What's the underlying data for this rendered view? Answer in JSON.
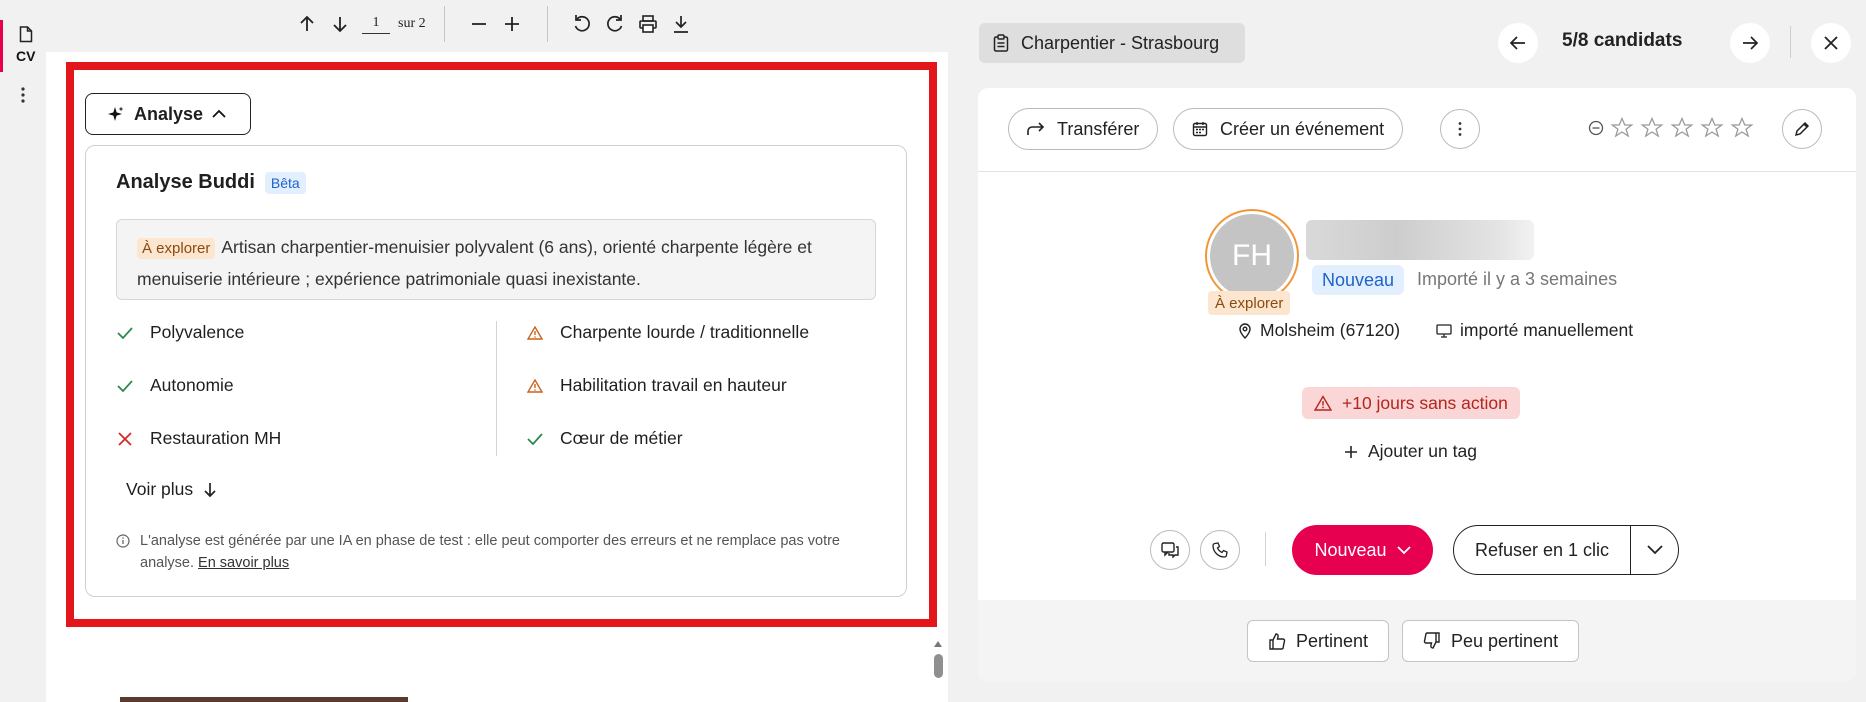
{
  "rail": {
    "cv_label": "CV",
    "icons": [
      "document-icon",
      "more-vertical-icon"
    ]
  },
  "pdf_toolbar": {
    "page_current": "1",
    "page_total": "sur 2"
  },
  "analysis": {
    "toggle_label": "Analyse",
    "title": "Analyse Buddi",
    "beta_badge": "Bêta",
    "summary_tag": "À explorer",
    "summary_text": "Artisan charpentier-menuisier polyvalent (6 ans), orienté charpente légère et menuiserie intérieure ; expérience patrimoniale quasi inexistante.",
    "criteria_left": [
      {
        "label": "Polyvalence",
        "status": "match"
      },
      {
        "label": "Autonomie",
        "status": "match"
      },
      {
        "label": "Restauration MH",
        "status": "miss"
      }
    ],
    "criteria_right": [
      {
        "label": "Charpente lourde / traditionnelle",
        "status": "warning"
      },
      {
        "label": "Habilitation travail en hauteur",
        "status": "warning"
      },
      {
        "label": "Cœur de métier",
        "status": "match"
      }
    ],
    "see_more": "Voir plus",
    "disclaimer": "L'analyse est générée par une IA en phase de test : elle peut comporter des erreurs et ne remplace pas votre analyse.",
    "learn_more": "En savoir plus"
  },
  "header": {
    "job": "Charpentier - Strasbourg",
    "counter": "5/8 candidats"
  },
  "candidate": {
    "actions": {
      "transfer": "Transférer",
      "create_event": "Créer un événement"
    },
    "initials": "FH",
    "avatar_tag": "À explorer",
    "status": "Nouveau",
    "imported": "Importé il y a 3 semaines",
    "location": "Molsheim (67120)",
    "source": "importé manuellement",
    "alert": "+10 jours sans action",
    "add_tag": "Ajouter un tag",
    "stage_button": "Nouveau",
    "refuse_button": "Refuser en 1 clic",
    "feedback_positive": "Pertinent",
    "feedback_negative": "Peu pertinent",
    "rating": 0
  },
  "colors": {
    "brand": "#e6004f",
    "highlight": "#e3161c",
    "info": "#1f63c7",
    "warning": "#c8641a",
    "success": "#2e8a4a",
    "danger": "#d62828"
  }
}
